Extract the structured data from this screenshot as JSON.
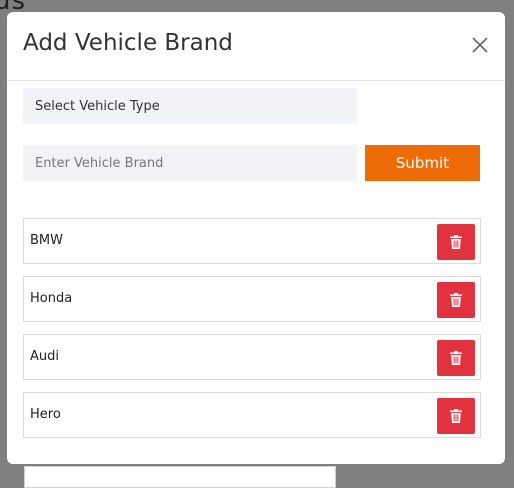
{
  "modal": {
    "title": "Add Vehicle Brand",
    "close_icon": "close-icon",
    "vehicle_type_select": {
      "placeholder": "Select Vehicle Type"
    },
    "brand_input": {
      "placeholder": "Enter Vehicle Brand",
      "value": ""
    },
    "submit_label": "Submit"
  },
  "brands": [
    {
      "name": "BMW",
      "delete_icon": "trash-icon"
    },
    {
      "name": "Honda",
      "delete_icon": "trash-icon"
    },
    {
      "name": "Audi",
      "delete_icon": "trash-icon"
    },
    {
      "name": "Hero",
      "delete_icon": "trash-icon"
    }
  ],
  "colors": {
    "accent": "#ee6c07",
    "danger": "#e0333f",
    "field_bg": "#f1f3f7",
    "overlay": "#7f7f7f"
  }
}
